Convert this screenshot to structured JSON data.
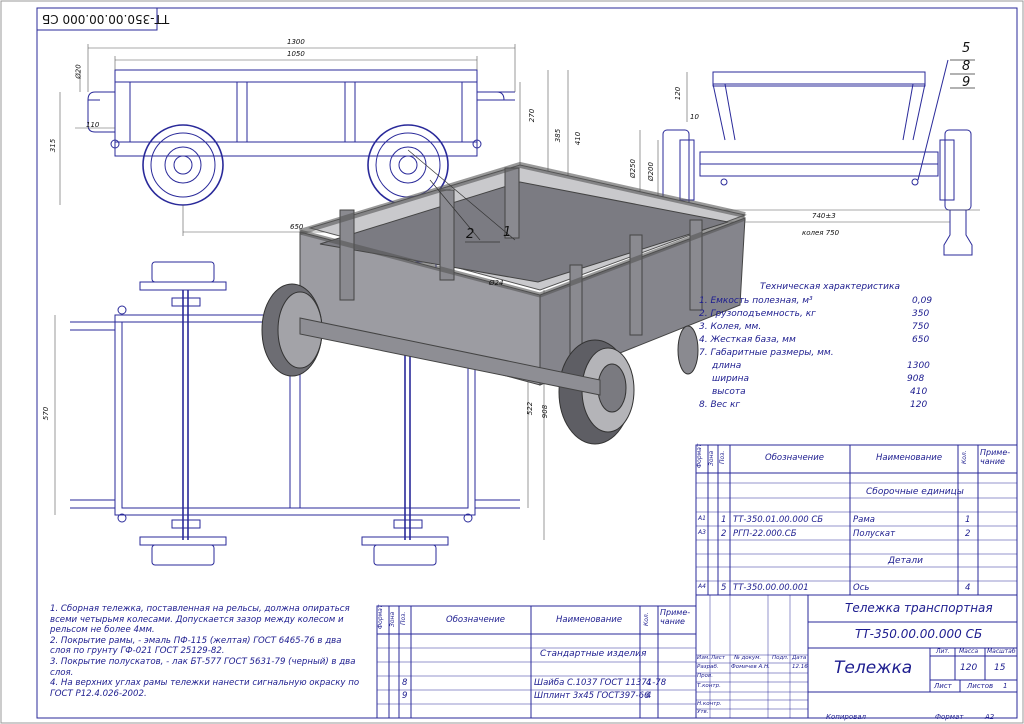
{
  "stamp_code": "ТТ-350.00.00.000 СБ",
  "dimensions": {
    "d1300": "1300",
    "d1050": "1050",
    "d20": "Ø20",
    "d110": "110",
    "d315": "315",
    "d270": "270",
    "d385": "385",
    "d410": "410",
    "d650": "650",
    "d570": "570",
    "d522": "522",
    "d908": "908",
    "d24": "Ø24",
    "d120": "120",
    "d10": "10",
    "d250": "Ø250",
    "d200": "Ø200",
    "d740": "740±3",
    "track": "колея 750"
  },
  "callouts": {
    "c1": "1",
    "c2": "2",
    "c5": "5",
    "c8": "8",
    "c9": "9"
  },
  "tech": {
    "title": "Техническая характеристика",
    "rows": [
      {
        "label": "1. Емкость полезная, м³",
        "value": "0,09"
      },
      {
        "label": "2. Грузоподъемность, кг",
        "value": "350"
      },
      {
        "label": "3. Колея, мм.",
        "value": "750"
      },
      {
        "label": "4. Жесткая база, мм",
        "value": "650"
      },
      {
        "label": "7. Габаритные размеры, мм.",
        "value": ""
      },
      {
        "label": "длина",
        "value": "1300"
      },
      {
        "label": "ширина",
        "value": "908"
      },
      {
        "label": "высота",
        "value": "410"
      },
      {
        "label": "8. Вес кг",
        "value": "120"
      }
    ]
  },
  "spec_right": {
    "headers": {
      "format": "Формат",
      "zone": "Зона",
      "pos": "Поз.",
      "designation": "Обозначение",
      "name": "Наименование",
      "qty": "Кол.",
      "note": "Приме-чание"
    },
    "section1": "Сборочные единицы",
    "rows1": [
      {
        "format": "А1",
        "pos": "1",
        "designation": "ТТ-350.01.00.000 СБ",
        "name": "Рама",
        "qty": "1"
      },
      {
        "format": "А3",
        "pos": "2",
        "designation": "РГП-22.000.СБ",
        "name": "Полускат",
        "qty": "2"
      }
    ],
    "section2": "Детали",
    "rows2": [
      {
        "format": "А4",
        "pos": "5",
        "designation": "ТТ-350.00.00.001",
        "name": "Ось",
        "qty": "4"
      }
    ]
  },
  "spec_left": {
    "headers": {
      "format": "Формат",
      "zone": "Зона",
      "pos": "Поз.",
      "designation": "Обозначение",
      "name": "Наименование",
      "qty": "Кол.",
      "note": "Приме-чание"
    },
    "section": "Стандартные изделия",
    "rows": [
      {
        "pos": "8",
        "name": "Шайба С.1037 ГОСТ 11371-78",
        "qty": "4"
      },
      {
        "pos": "9",
        "name": "Шплинт 3х45 ГОСТ397-66",
        "qty": "4"
      }
    ]
  },
  "notes": [
    "1. Сборная тележка, поставленная на рельсы, должна опираться всеми четырьмя колесами. Допускается зазор между колесом и рельсом не более 4мм.",
    "2. Покрытие рамы, - эмаль ПФ-115 (желтая) ГОСТ 6465-76 в два слоя по грунту ГФ-021 ГОСТ 25129-82.",
    "3. Покрытие полускатов, - лак БТ-577 ГОСТ 5631-79 (черный) в два слоя.",
    "4. На верхних углах рамы тележки нанести сигнальную окраску по ГОСТ Р12.4.026-2002."
  ],
  "title_block": {
    "product": "Тележка транспортная",
    "code": "ТТ-350.00.00.000 СБ",
    "name": "Тележка",
    "lit_label": "Лит.",
    "mass_label": "Масса",
    "scale_label": "Масштаб",
    "mass": "120",
    "scale": "15",
    "sheet_label": "Лист",
    "sheets_label": "Листов",
    "sheets": "1",
    "rows": {
      "izm": "Изм.",
      "list": "Лист",
      "doc": "№ докум.",
      "sign": "Подп.",
      "date": "Дата",
      "dev": "Разраб.",
      "dev_name": "Фомичев А.Н.",
      "dev_date": "12.16",
      "check": "Пров.",
      "tcontr": "Т.контр.",
      "ncontr": "Н.контр.",
      "approve": "Утв."
    },
    "copied": "Копировал",
    "format_label": "Формат",
    "format": "А2"
  }
}
